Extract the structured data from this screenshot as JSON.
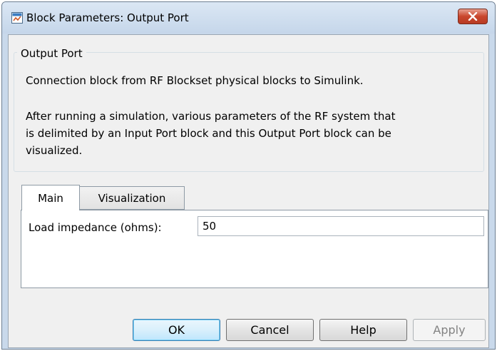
{
  "window": {
    "title": "Block Parameters: Output Port"
  },
  "group": {
    "title": "Output Port",
    "description_1": "Connection block from RF Blockset physical blocks to Simulink.",
    "description_2_line_1": "After running a simulation, various parameters of the RF system that",
    "description_2_line_2": "is delimited by an Input Port block and this Output Port block can be",
    "description_2_line_3": "visualized."
  },
  "tabs": [
    {
      "label": "Main",
      "active": true
    },
    {
      "label": "Visualization",
      "active": false
    }
  ],
  "main_tab": {
    "load_impedance_label": "Load impedance (ohms):",
    "load_impedance_value": "50"
  },
  "buttons": {
    "ok": "OK",
    "cancel": "Cancel",
    "help": "Help",
    "apply": "Apply"
  },
  "icons": {
    "title": "simulink-block-icon",
    "close": "close-icon"
  },
  "colors": {
    "close_button": "#c9462c",
    "window_frame": "#c9d9eb",
    "default_button_border": "#3c7fb1",
    "disabled_text": "#838383"
  }
}
